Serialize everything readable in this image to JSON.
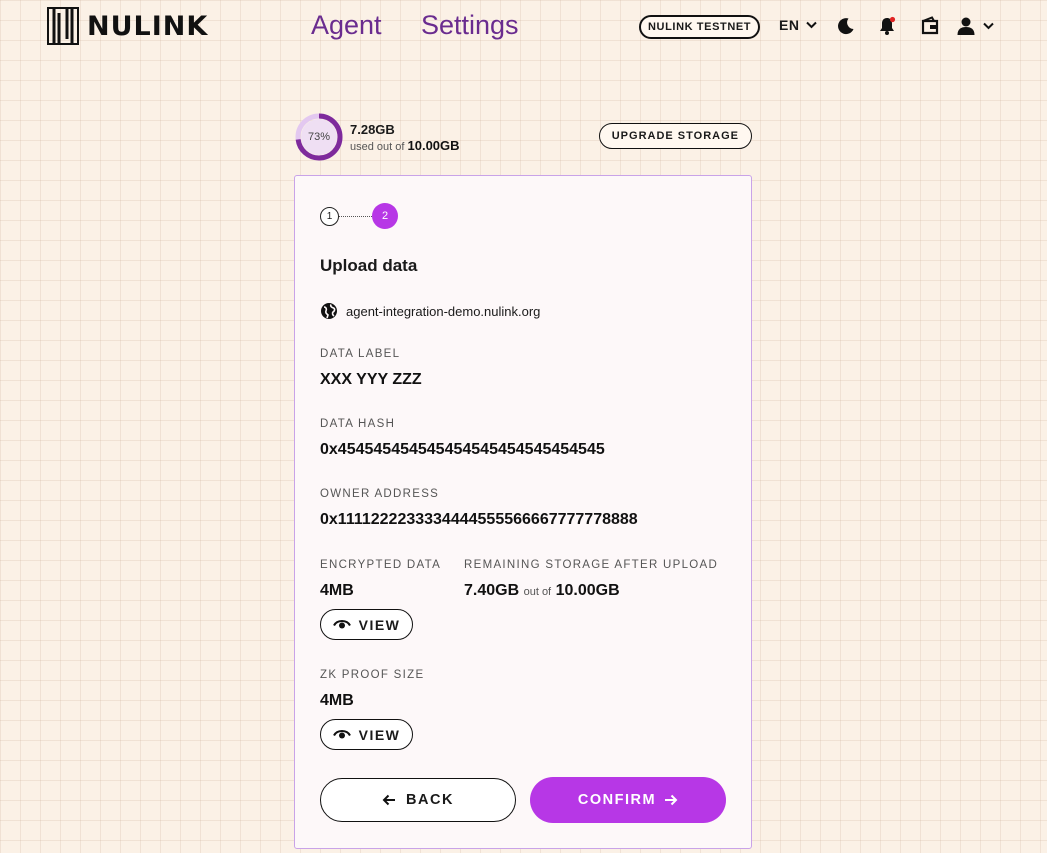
{
  "header": {
    "logo_text": "NULINK",
    "nav": [
      {
        "label": "Agent"
      },
      {
        "label": "Settings"
      }
    ],
    "network_badge": "NULINK TESTNET",
    "language": "EN"
  },
  "storage": {
    "percent_label": "73%",
    "percent_value": 0.73,
    "used": "7.28GB",
    "used_out_of_label": "used out of",
    "total": "10.00GB",
    "upgrade_label": "UPGRADE STORAGE"
  },
  "card": {
    "steps": [
      "1",
      "2"
    ],
    "current_step": 2,
    "title": "Upload data",
    "domain": "agent-integration-demo.nulink.org",
    "data_label": {
      "label": "DATA LABEL",
      "value": "XXX YYY ZZZ"
    },
    "data_hash": {
      "label": "DATA HASH",
      "value": "0x454545454545454545454545454545"
    },
    "owner_address": {
      "label": "OWNER ADDRESS",
      "value": "0x1111222233334444555566667777778888"
    },
    "encrypted_data": {
      "label": "ENCRYPTED DATA",
      "value": "4MB",
      "view_label": "VIEW"
    },
    "remaining_storage": {
      "label": "REMAINING STORAGE AFTER UPLOAD",
      "value": "7.40GB",
      "out_of_label": "out of",
      "total": "10.00GB"
    },
    "zk_proof": {
      "label": "ZK PROOF SIZE",
      "value": "4MB",
      "view_label": "VIEW"
    },
    "back_label": "BACK",
    "confirm_label": "CONFIRM"
  },
  "colors": {
    "accent": "#b737e6",
    "nav": "#6a2c8f",
    "background": "#fbf1e6"
  }
}
